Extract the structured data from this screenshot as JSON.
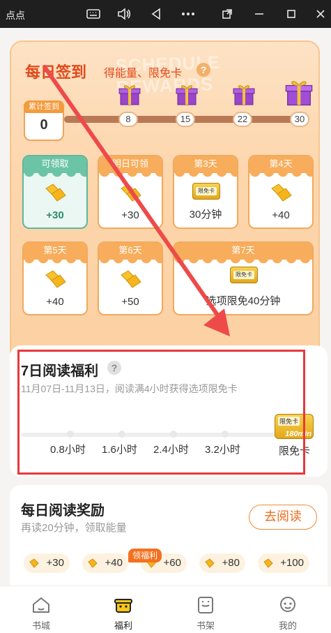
{
  "window": {
    "title": "点点",
    "buttons": [
      "keyboard-icon",
      "volume-icon",
      "back-icon",
      "more-icon",
      "popout-icon",
      "minimize-icon",
      "maximize-icon",
      "close-icon"
    ]
  },
  "signin": {
    "title": "每日签到",
    "subtitle": "得能量、限免卡",
    "watermark": "SCHEDULE REWARDS",
    "cumulative_label": "累计签到",
    "cumulative_count": "0",
    "milestones": [
      "8",
      "15",
      "22",
      "30"
    ],
    "days": [
      {
        "label": "可领取",
        "amount": "+30",
        "state": "claimable"
      },
      {
        "label": "明日可领",
        "amount": "+30",
        "state": "locked"
      },
      {
        "label": "第3天",
        "amount": "30分钟",
        "reward": "限免卡",
        "state": "locked"
      },
      {
        "label": "第4天",
        "amount": "+40",
        "state": "locked"
      },
      {
        "label": "第5天",
        "amount": "+40",
        "state": "locked"
      },
      {
        "label": "第6天",
        "amount": "+50",
        "state": "locked"
      },
      {
        "label": "第7天",
        "amount": "选项限免40分钟",
        "reward": "限免卡",
        "state": "locked"
      }
    ]
  },
  "read7": {
    "title": "7日阅读福利",
    "description": "11月07日-11月13日，阅读满4小时获得选项限免卡",
    "steps": [
      "0.8小时",
      "1.6小时",
      "2.4小时",
      "3.2小时"
    ],
    "final_label": "限免卡",
    "card_tag": "限免卡",
    "card_minutes": "180min"
  },
  "daily": {
    "title": "每日阅读奖励",
    "description": "再读20分钟，领取能量",
    "go_button": "去阅读",
    "rewards": [
      "+30",
      "+40",
      "+60",
      "+80",
      "+100"
    ]
  },
  "nav": {
    "badge": "领福利",
    "items": [
      {
        "label": "书城",
        "icon": "bookstore-icon",
        "active": false
      },
      {
        "label": "福利",
        "icon": "welfare-icon",
        "active": true
      },
      {
        "label": "书架",
        "icon": "bookshelf-icon",
        "active": false
      },
      {
        "label": "我的",
        "icon": "profile-icon",
        "active": false
      }
    ]
  },
  "colors": {
    "accent_red": "#e2491c",
    "orange": "#f7ad5b",
    "claim_green": "#6cc4a6",
    "annotation_red": "#e8383b"
  }
}
